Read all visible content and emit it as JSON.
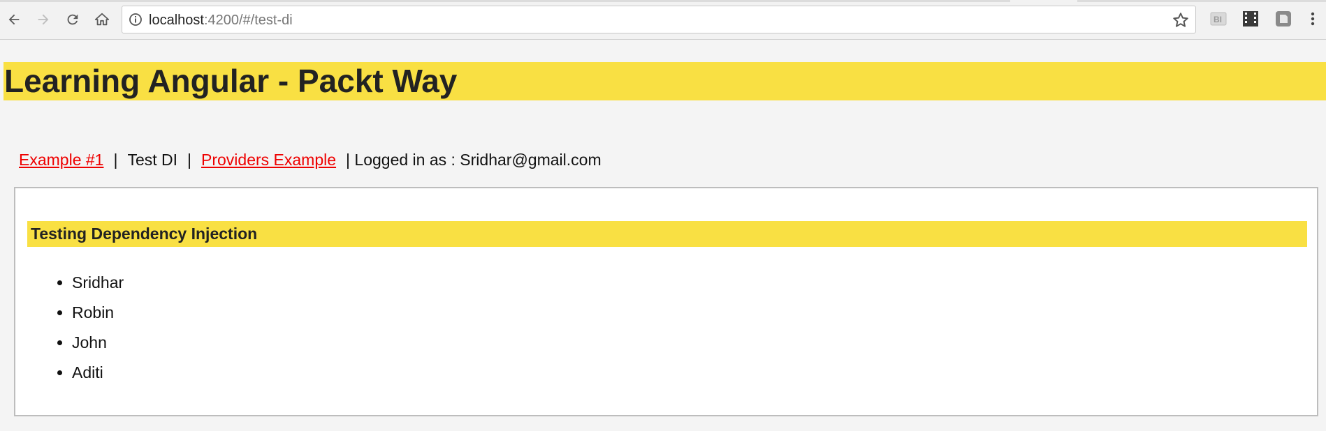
{
  "browser": {
    "url_host": "localhost",
    "url_path": ":4200/#/test-di",
    "icons": {
      "back": "back-arrow-icon",
      "forward": "forward-arrow-icon",
      "reload": "reload-icon",
      "home": "home-icon",
      "info": "info-icon",
      "bookmark": "star-icon",
      "extensions": [
        "bi-extension-icon",
        "film-extension-icon",
        "evernote-extension-icon"
      ],
      "menu": "kebab-menu-icon"
    }
  },
  "app": {
    "title": "Learning Angular - Packt Way"
  },
  "nav": {
    "link_example1": "Example #1",
    "separator": "|",
    "current": "Test DI",
    "link_providers": "Providers Example",
    "logged_in": "| Logged in as : Sridhar@gmail.com"
  },
  "panel": {
    "title": "Testing Dependency Injection",
    "users": [
      "Sridhar",
      "Robin",
      "John",
      "Aditi"
    ]
  },
  "colors": {
    "accent_yellow": "#f9e043",
    "link_red": "#ee0000"
  }
}
